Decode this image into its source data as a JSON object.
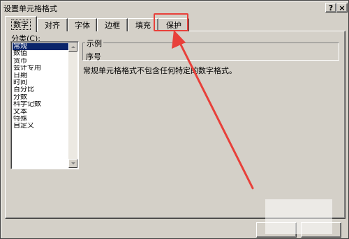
{
  "window": {
    "title": "设置单元格格式",
    "help_label": "?",
    "close_label": "×"
  },
  "tabs": [
    {
      "label": "数字",
      "active": true
    },
    {
      "label": "对齐",
      "active": false
    },
    {
      "label": "字体",
      "active": false
    },
    {
      "label": "边框",
      "active": false
    },
    {
      "label": "填充",
      "active": false
    },
    {
      "label": "保护",
      "active": false
    }
  ],
  "category": {
    "label": "分类(C):",
    "items": [
      "常规",
      "数值",
      "货币",
      "会计专用",
      "日期",
      "时间",
      "百分比",
      "分数",
      "科学记数",
      "文本",
      "特殊",
      "自定义"
    ],
    "selected_index": 0
  },
  "sample": {
    "legend": "示例",
    "value": "序号"
  },
  "description": "常规单元格格式不包含任何特定的数字格式。",
  "annotation": {
    "color": "#e8403a",
    "highlighted_tab": "保护"
  },
  "colors": {
    "dialog_bg": "#d4d0c8",
    "selection": "#0a246a"
  }
}
